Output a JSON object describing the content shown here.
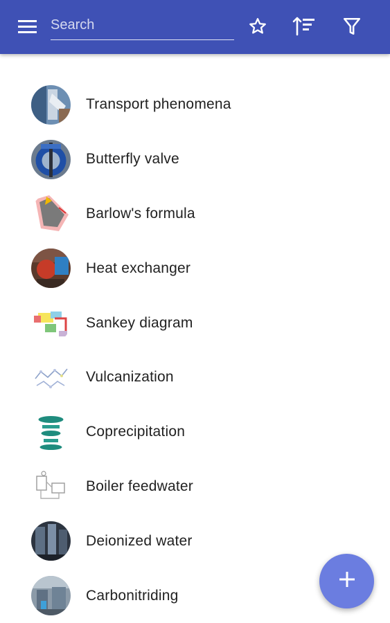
{
  "app_bar": {
    "search_placeholder": "Search",
    "icons": {
      "menu": "menu-icon",
      "star": "star-outline-icon",
      "sort": "sort-icon",
      "filter": "filter-icon"
    }
  },
  "list": {
    "items": [
      {
        "label": "Transport phenomena"
      },
      {
        "label": "Butterfly valve"
      },
      {
        "label": "Barlow's formula"
      },
      {
        "label": "Heat exchanger"
      },
      {
        "label": "Sankey diagram"
      },
      {
        "label": "Vulcanization"
      },
      {
        "label": "Coprecipitation"
      },
      {
        "label": "Boiler feedwater"
      },
      {
        "label": "Deionized water"
      },
      {
        "label": "Carbonitriding"
      }
    ]
  },
  "fab": {
    "icon": "plus-icon"
  },
  "colors": {
    "app_bar": "#3f51b5",
    "fab": "#6b7de0",
    "text": "#212121"
  }
}
